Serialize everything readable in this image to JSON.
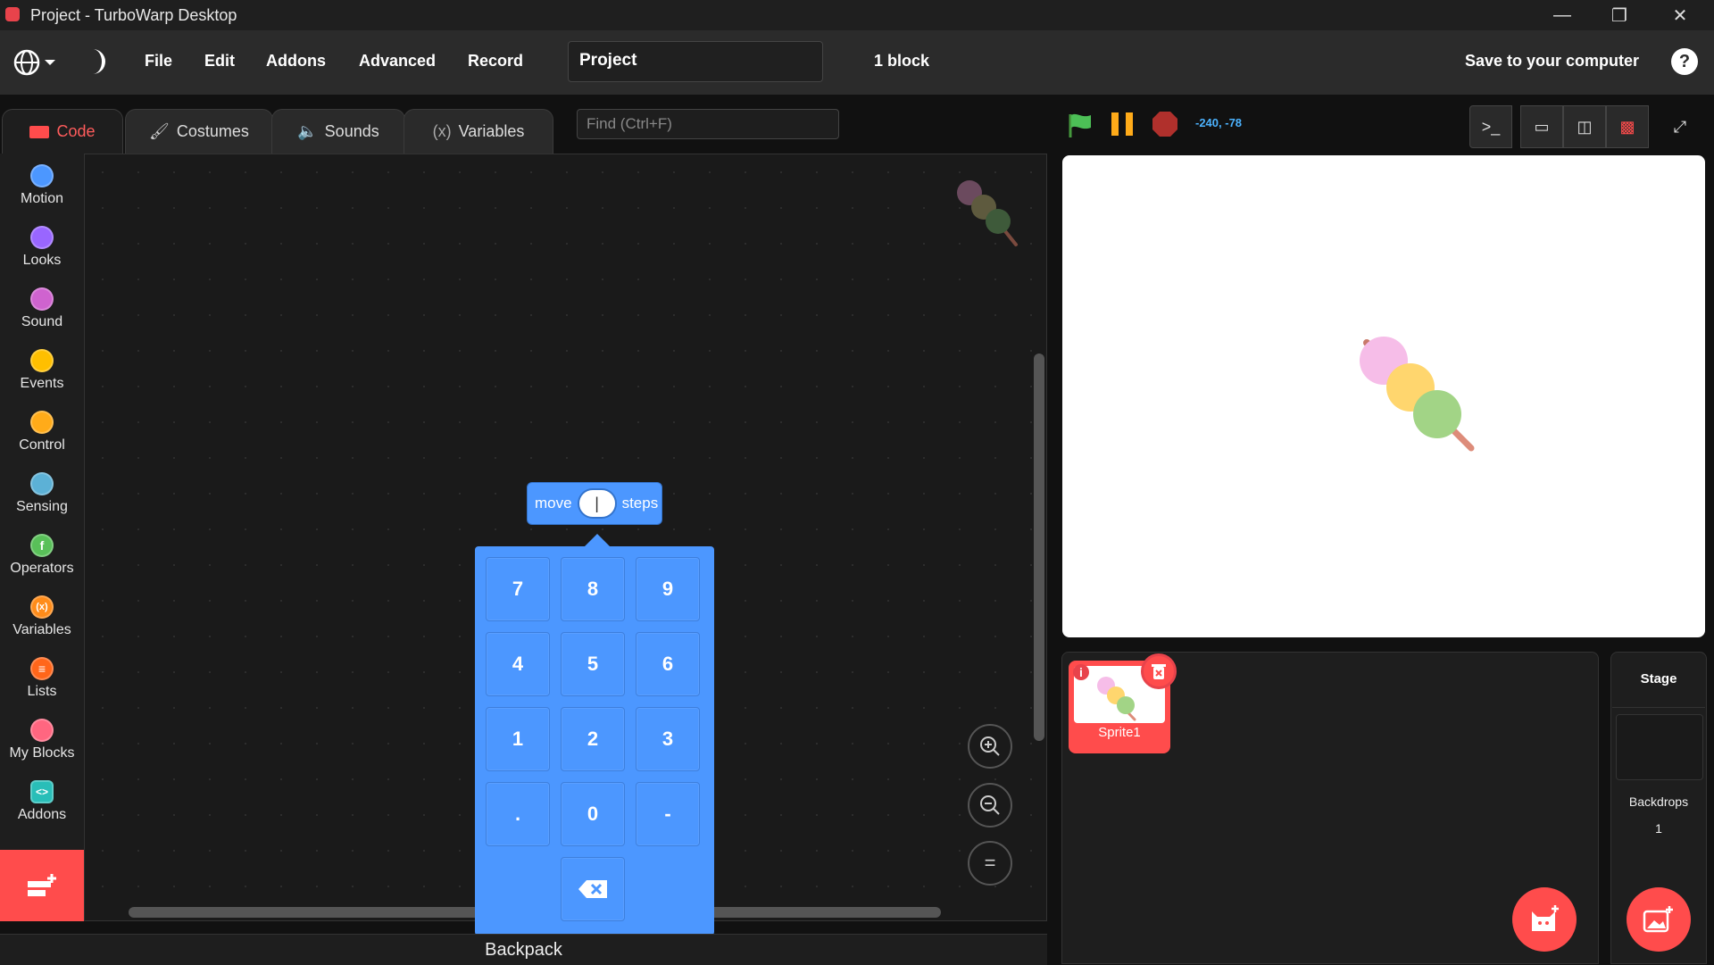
{
  "window": {
    "title": "Project - TurboWarp Desktop"
  },
  "menu": {
    "file": "File",
    "edit": "Edit",
    "addons": "Addons",
    "advanced": "Advanced",
    "record": "Record",
    "project_title": "Project",
    "block_count": "1 block",
    "save": "Save to your computer",
    "help": "?"
  },
  "tabs": {
    "code": "Code",
    "costumes": "Costumes",
    "sounds": "Sounds",
    "variables": "Variables"
  },
  "find": {
    "placeholder": "Find (Ctrl+F)"
  },
  "categories": [
    {
      "label": "Motion",
      "color": "#4c97ff"
    },
    {
      "label": "Looks",
      "color": "#9966ff"
    },
    {
      "label": "Sound",
      "color": "#cf63cf"
    },
    {
      "label": "Events",
      "color": "#ffbf00"
    },
    {
      "label": "Control",
      "color": "#ffab19"
    },
    {
      "label": "Sensing",
      "color": "#5cb1d6"
    },
    {
      "label": "Operators",
      "color": "#59c059"
    },
    {
      "label": "Variables",
      "color": "#ff8c1a"
    },
    {
      "label": "Lists",
      "color": "#ff661a"
    },
    {
      "label": "My Blocks",
      "color": "#ff6680"
    },
    {
      "label": "Addons",
      "color": "#29beb8"
    }
  ],
  "block": {
    "move": "move",
    "value": "|",
    "steps": "steps"
  },
  "numpad": {
    "keys": [
      "7",
      "8",
      "9",
      "4",
      "5",
      "6",
      "1",
      "2",
      "3",
      ".",
      "0",
      "-"
    ]
  },
  "workspace": {
    "backpack": "Backpack"
  },
  "stage": {
    "coords": "-240, -78"
  },
  "sprites": {
    "sprite1": "Sprite1"
  },
  "stage_pane": {
    "title": "Stage",
    "backdrops_label": "Backdrops",
    "backdrops_count": "1"
  }
}
